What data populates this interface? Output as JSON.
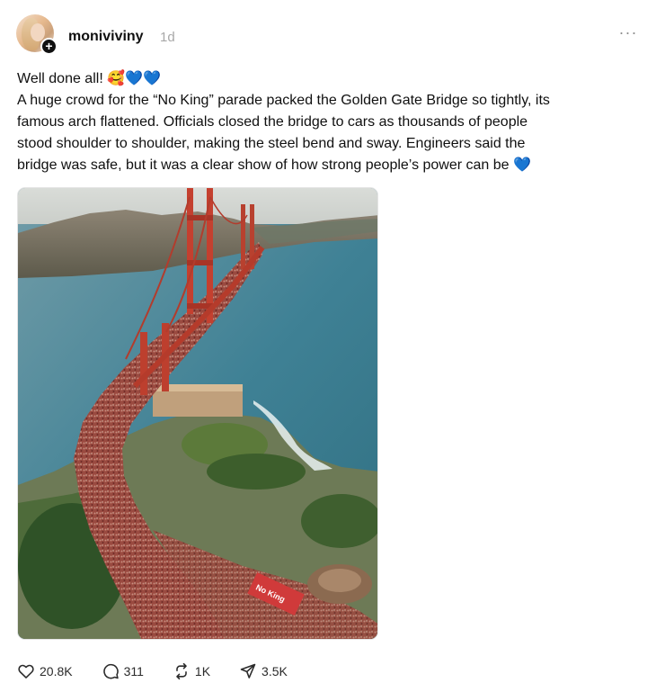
{
  "post": {
    "username": "moniviviny",
    "timestamp": "1d",
    "more_glyph": "···",
    "text_lines": [
      "Well done all! 🥰💙💙",
      "A huge crowd for the “No King” parade packed the Golden Gate Bridge so tightly, its",
      "famous arch flattened. Officials closed the bridge to cars as thousands of people",
      "stood shoulder to shoulder, making the steel bend and sway. Engineers said the",
      "bridge was safe, but it was a clear show of how strong people’s power can be 💙"
    ],
    "image_description_icon": "aerial-bridge-crowd-photo",
    "image_caption_text": "No King"
  },
  "actions": {
    "likes": "20.8K",
    "comments": "311",
    "reposts": "1K",
    "shares": "3.5K"
  },
  "icons": {
    "like": "heart-icon",
    "comment": "comment-bubble-icon",
    "repost": "repost-icon",
    "share": "share-icon",
    "follow": "plus-icon",
    "more": "more-icon"
  },
  "colors": {
    "text": "#101010",
    "muted": "#a8a8a8",
    "bridge": "#c4402f",
    "water": "#4e8aa1"
  }
}
